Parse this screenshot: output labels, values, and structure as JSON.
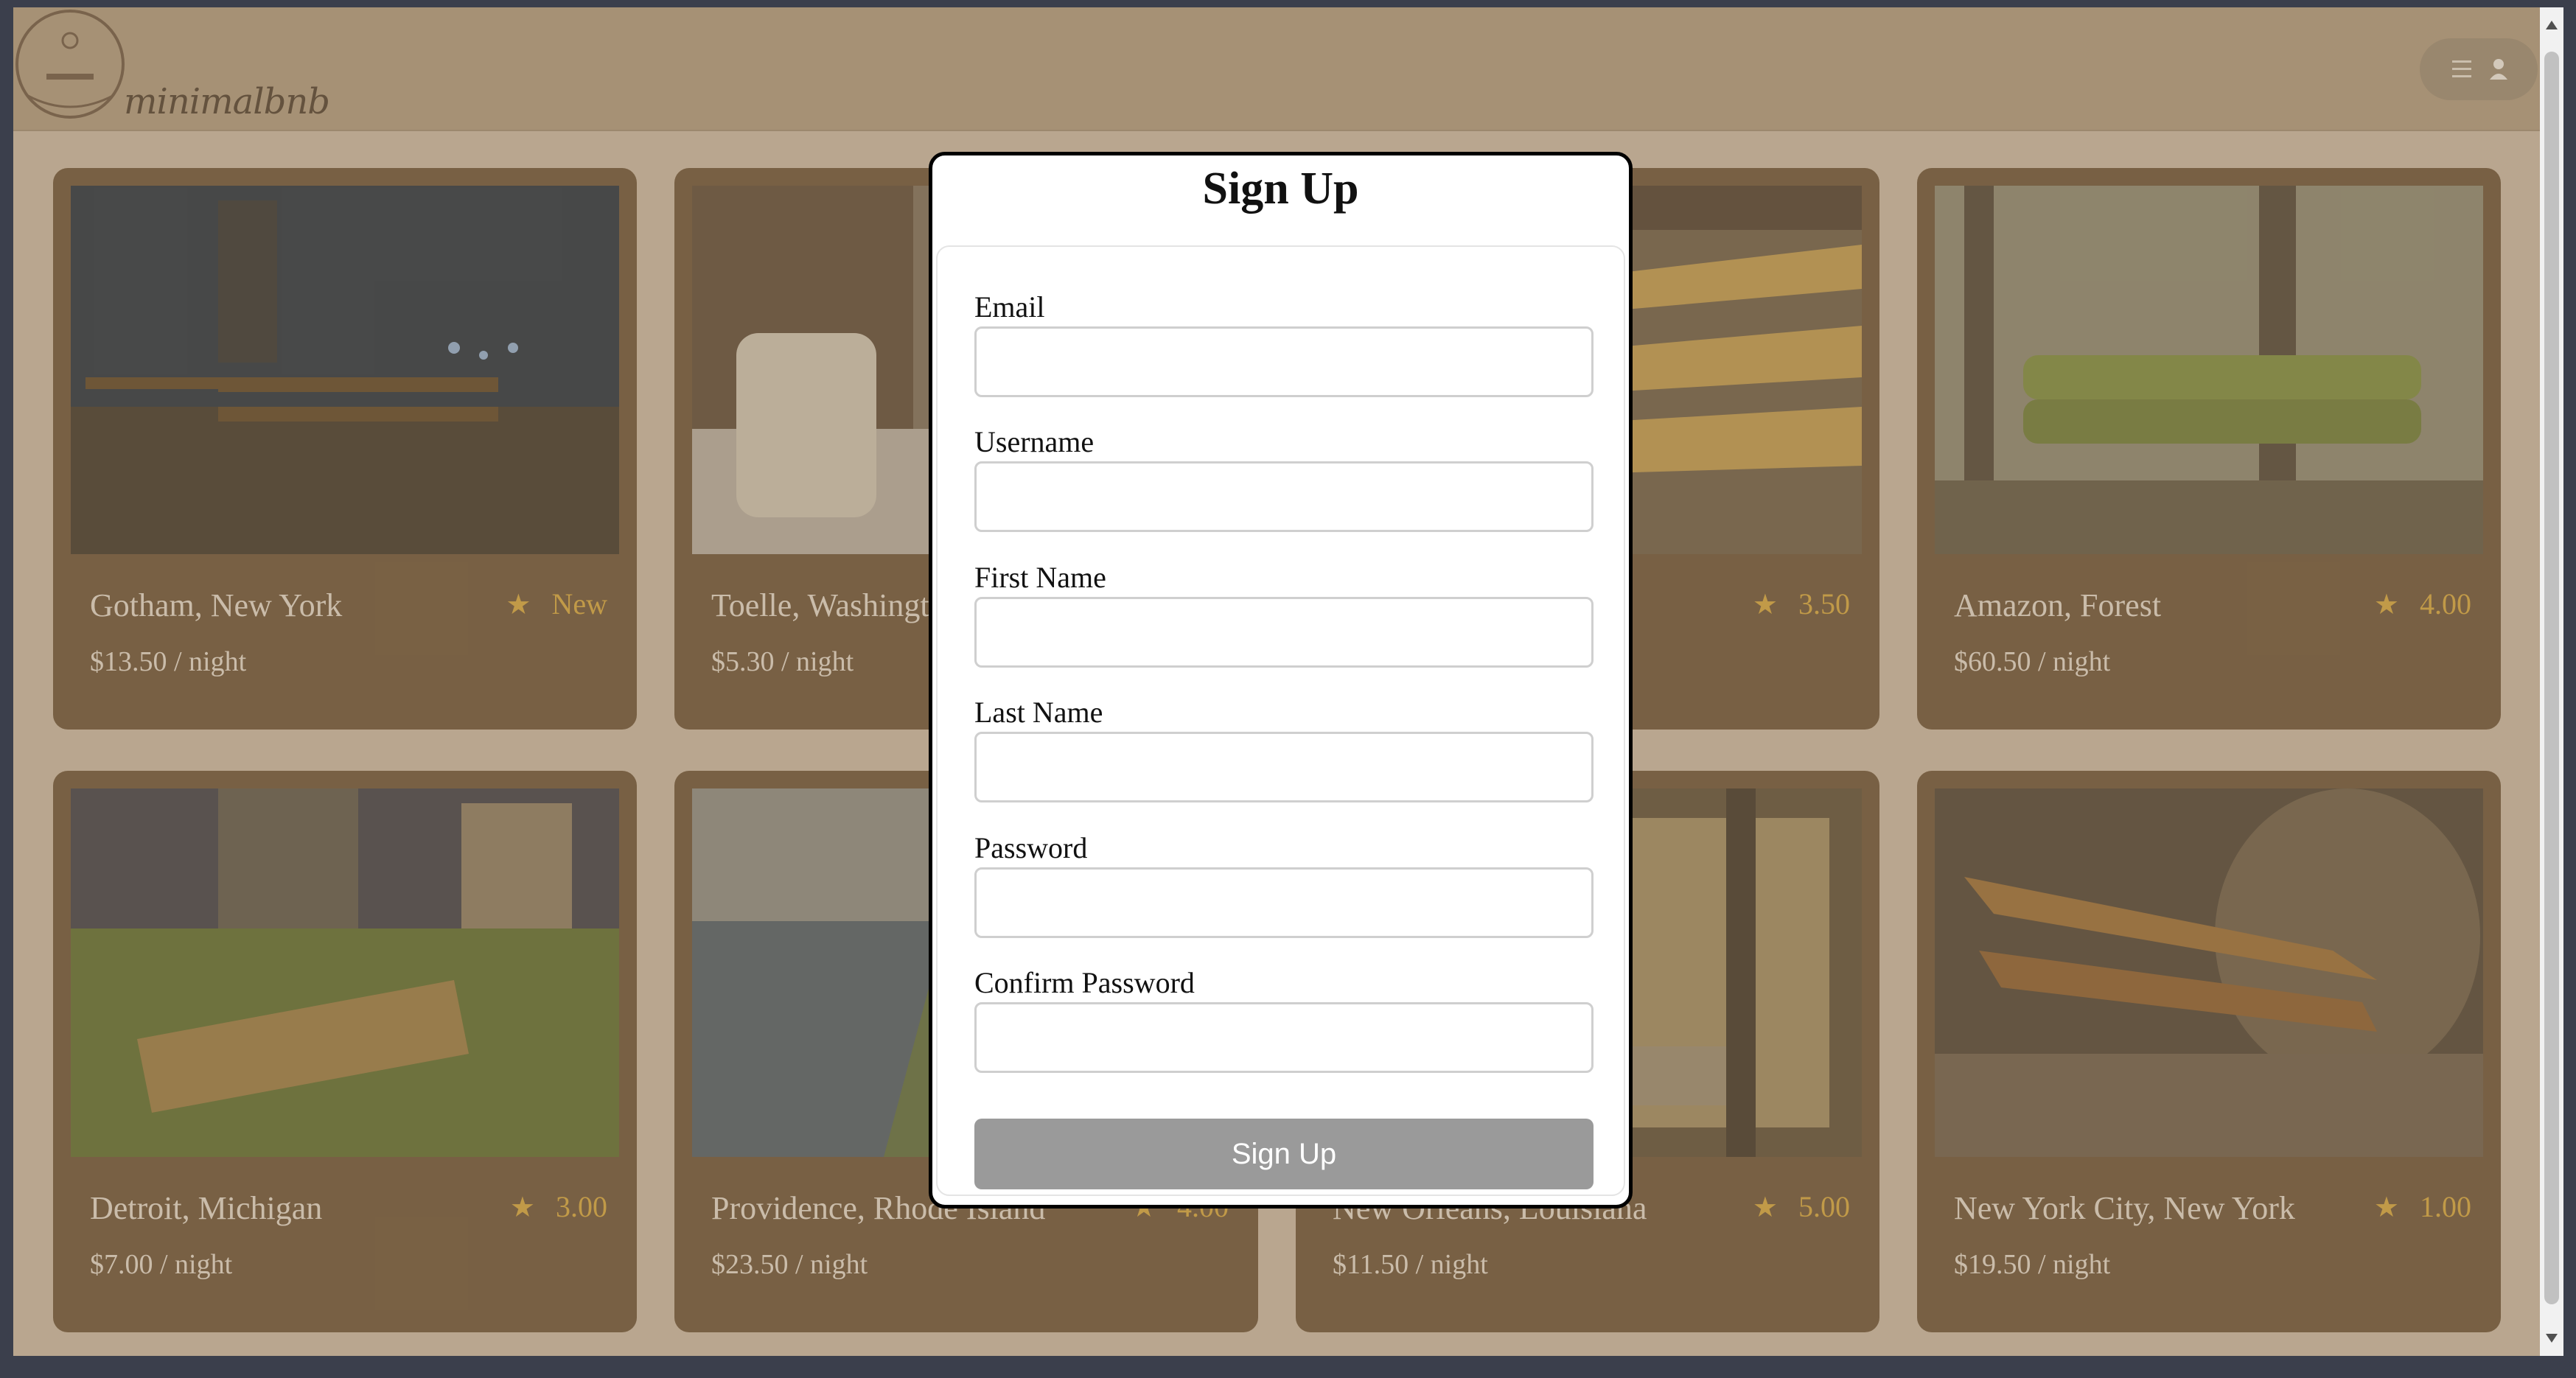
{
  "app": {
    "brand": "minimalbnb"
  },
  "listings": [
    {
      "title": "Gotham, New York",
      "rating": "New",
      "price": "$13.50 / night"
    },
    {
      "title": "Toelle, Washington",
      "rating": "",
      "price": "$5.30 / night"
    },
    {
      "title": "",
      "rating": "3.50",
      "price": ""
    },
    {
      "title": "Amazon, Forest",
      "rating": "4.00",
      "price": "$60.50 / night"
    },
    {
      "title": "Detroit, Michigan",
      "rating": "3.00",
      "price": "$7.00 / night"
    },
    {
      "title": "Providence, Rhode Island",
      "rating": "4.00",
      "price": "$23.50 / night"
    },
    {
      "title": "New Orleans, Louisiana",
      "rating": "5.00",
      "price": "$11.50 / night"
    },
    {
      "title": "New York City, New York",
      "rating": "1.00",
      "price": "$19.50 / night"
    }
  ],
  "modal": {
    "title": "Sign Up",
    "fields": [
      {
        "label": "Email",
        "value": ""
      },
      {
        "label": "Username",
        "value": ""
      },
      {
        "label": "First Name",
        "value": ""
      },
      {
        "label": "Last Name",
        "value": ""
      },
      {
        "label": "Password",
        "value": ""
      },
      {
        "label": "Confirm Password",
        "value": ""
      }
    ],
    "submit_label": "Sign Up"
  },
  "icons": {
    "menu": "hamburger-icon",
    "user": "user-icon",
    "star": "star-icon"
  },
  "colors": {
    "header": "#b09a7e",
    "card": "#694f33",
    "accent": "#d9a83a",
    "button": "#9a9a9a"
  }
}
